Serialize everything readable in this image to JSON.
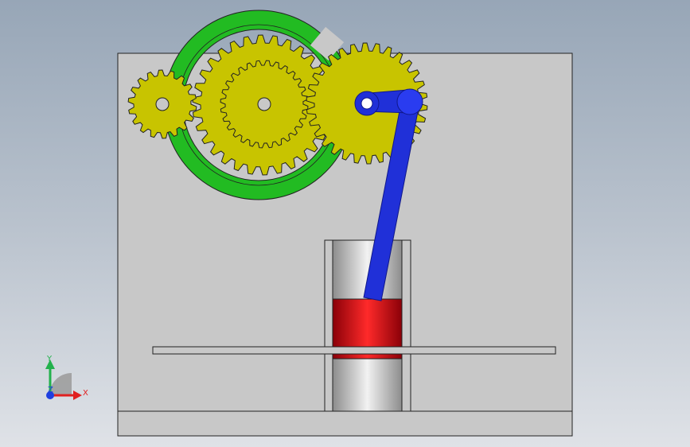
{
  "triad": {
    "x_label": "X",
    "y_label": "Y",
    "z_label": "Z",
    "x_color": "#e02020",
    "y_color": "#22b14c",
    "z_color": "#1f3fe0"
  },
  "colors": {
    "plate": "#c8c8c8",
    "gear": "#c8c400",
    "ring": "#22bb22",
    "link": "#2030d8",
    "piston": "#c00010",
    "cylinder": "#cccccc"
  }
}
